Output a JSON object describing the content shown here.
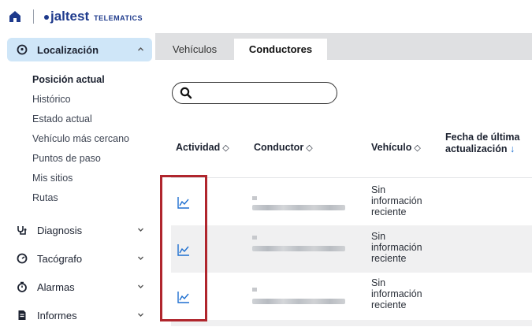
{
  "header": {
    "home_icon": "home-icon",
    "brand_main": "jaltest",
    "brand_sub": "TELEMATICS"
  },
  "sidebar": {
    "sections": [
      {
        "label": "Localización",
        "icon": "location-pin-icon",
        "expanded": true
      },
      {
        "label": "Diagnosis",
        "icon": "diagnosis-icon",
        "expanded": false
      },
      {
        "label": "Tacógrafo",
        "icon": "tachograph-icon",
        "expanded": false
      },
      {
        "label": "Alarmas",
        "icon": "stopwatch-icon",
        "expanded": false
      },
      {
        "label": "Informes",
        "icon": "document-icon",
        "expanded": false
      }
    ],
    "localizacion_items": [
      "Posición actual",
      "Histórico",
      "Estado actual",
      "Vehículo más cercano",
      "Puntos de paso",
      "Mis sitios",
      "Rutas"
    ]
  },
  "tabs": [
    "Vehículos",
    "Conductores"
  ],
  "active_tab": "Conductores",
  "search": {
    "placeholder": "",
    "value": ""
  },
  "table": {
    "columns": {
      "actividad": "Actividad",
      "conductor": "Conductor",
      "vehiculo": "Vehículo",
      "fecha_line1": "Fecha de última",
      "fecha_line2": "actualización",
      "sort_icon": "◇",
      "sort_desc": "↓"
    },
    "rows": [
      {
        "vehiculo": [
          "Sin",
          "información",
          "reciente"
        ]
      },
      {
        "vehiculo": [
          "Sin",
          "información",
          "reciente"
        ]
      },
      {
        "vehiculo": [
          "Sin",
          "información",
          "reciente"
        ]
      }
    ]
  },
  "colors": {
    "brand": "#1e3a8c",
    "active_section_bg": "#cfe6f8",
    "highlight_box": "#b0262d",
    "activity_icon": "#1e6fd0"
  }
}
